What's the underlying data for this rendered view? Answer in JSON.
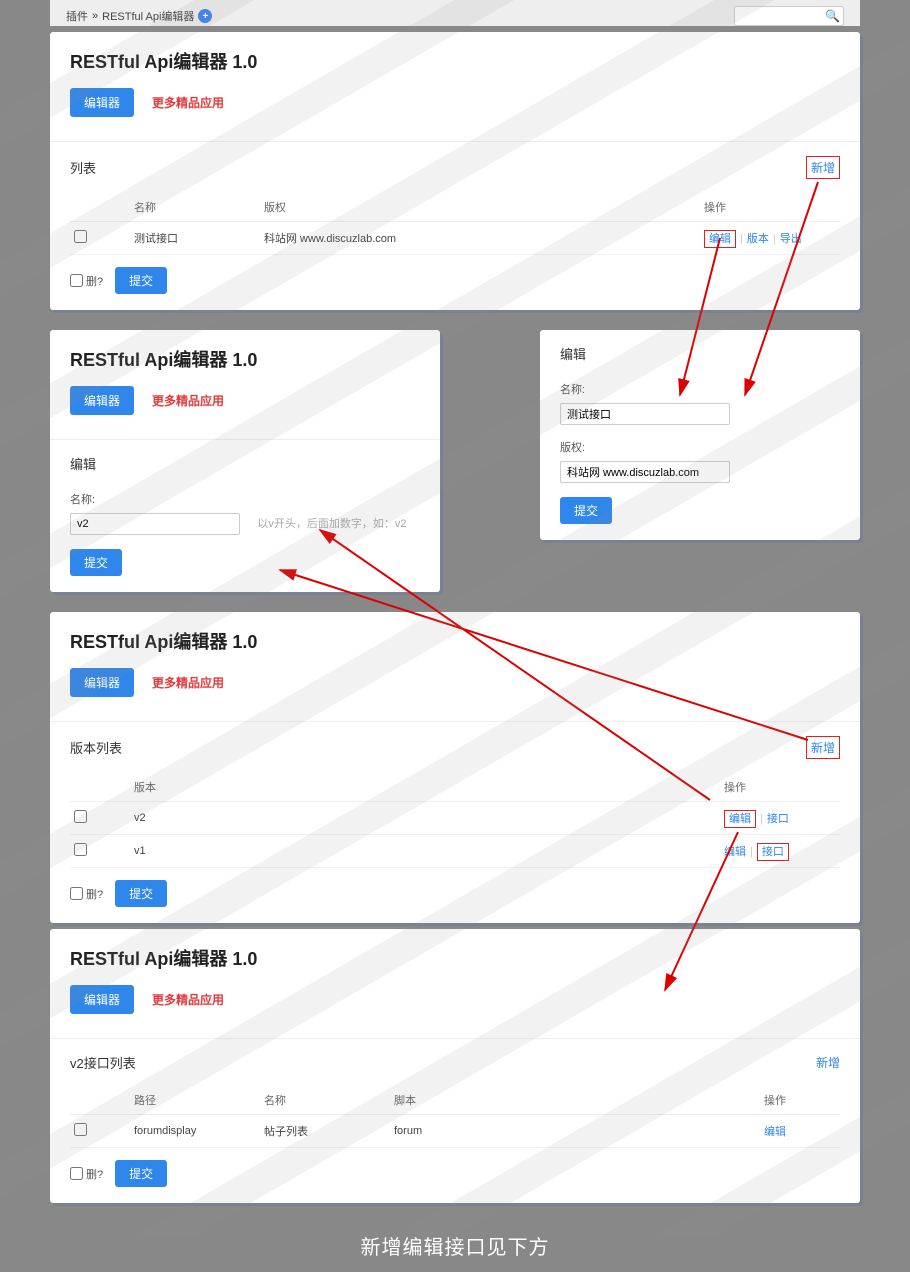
{
  "breadcrumb": {
    "plugin": "插件",
    "sep": "»",
    "current": "RESTful Api编辑器",
    "search_placeholder": ""
  },
  "panel1": {
    "title": "RESTful Api编辑器 1.0",
    "tab_editor": "编辑器",
    "tab_more": "更多精品应用",
    "list_title": "列表",
    "add": "新增",
    "cols": {
      "name": "名称",
      "copyright": "版权",
      "op": "操作"
    },
    "rows": [
      {
        "name": "测试接口",
        "copyright": "科站网 www.discuzlab.com",
        "edit": "编辑",
        "version": "版本",
        "export": "导出"
      }
    ],
    "delq": "删?",
    "submit": "提交"
  },
  "panel2left": {
    "title": "RESTful Api编辑器 1.0",
    "tab_editor": "编辑器",
    "tab_more": "更多精品应用",
    "form_title": "编辑",
    "label_name": "名称:",
    "val_name": "v2",
    "hint": "以v开头，后面加数字，如：v2",
    "submit": "提交"
  },
  "panel2right": {
    "form_title": "编辑",
    "label_name": "名称:",
    "val_name": "测试接口",
    "label_copyright": "版权:",
    "val_copyright": "科站网 www.discuzlab.com",
    "submit": "提交"
  },
  "panel3": {
    "title": "RESTful Api编辑器 1.0",
    "tab_editor": "编辑器",
    "tab_more": "更多精品应用",
    "list_title": "版本列表",
    "add": "新增",
    "cols": {
      "version": "版本",
      "op": "操作"
    },
    "rows": [
      {
        "version": "v2",
        "edit": "编辑",
        "iface": "接口"
      },
      {
        "version": "v1",
        "edit": "编辑",
        "iface": "接口"
      }
    ],
    "delq": "删?",
    "submit": "提交"
  },
  "panel4": {
    "title": "RESTful Api编辑器 1.0",
    "tab_editor": "编辑器",
    "tab_more": "更多精品应用",
    "list_title": "v2接口列表",
    "add": "新增",
    "cols": {
      "path": "路径",
      "name": "名称",
      "script": "脚本",
      "op": "操作"
    },
    "rows": [
      {
        "path": "forumdisplay",
        "name": "帖子列表",
        "script": "forum",
        "edit": "编辑"
      }
    ],
    "delq": "删?",
    "submit": "提交"
  },
  "caption": "新增编辑接口见下方"
}
